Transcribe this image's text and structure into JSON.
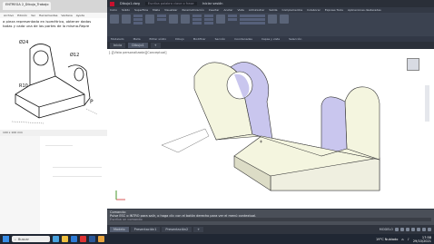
{
  "paint": {
    "tab_title": "ENTREGA 2_Dibujo_Trabajo",
    "tab2": "Herramientas",
    "menu": [
      "Archivo",
      "Edición",
      "Ver",
      "Herramientas",
      "Ventana",
      "Ayuda"
    ],
    "text_line1": "a pieza representada en isométrico, obtener dadas",
    "text_line2": "todas y cada una de las partes de la misma.Repre",
    "dims": {
      "d1": "Ø24",
      "d2": "Ø12",
      "d3": "R10",
      "p": "P"
    },
    "status": "100 x 100 mm"
  },
  "cad": {
    "title": "Dibujo1.dwg",
    "search_placeholder": "Escriba palabra clave o frase",
    "user": "Iniciar sesión",
    "tabs": [
      "Inicio",
      "Sólido",
      "Superficie",
      "Malla",
      "Visualizar",
      "Parametrización",
      "Insertar",
      "Anotar",
      "Vista",
      "Administrar",
      "Salida",
      "Complementos",
      "Colaborar",
      "Express Tools",
      "Aplicaciones destacadas"
    ],
    "panels": [
      "Modelado",
      "Malla",
      "Editar sólido",
      "Dibujo",
      "Modificar",
      "Sección",
      "Coordenadas",
      "Capas y vista",
      "Selección"
    ],
    "file_tabs": [
      "Inicio",
      "Dibujo1"
    ],
    "viewport_label": "[-][Vista personalizada][Conceptual]",
    "cmd_lines": [
      "Comando:",
      "Pulse ESC o INTRO para salir, o haga clic con el botón derecho para ver el menú contextual."
    ],
    "cmd_prompt": "Escriba un comando",
    "layouts": [
      "Modelo",
      "Presentación1",
      "Presentación2"
    ],
    "status_text": "MODELO"
  },
  "taskbar": {
    "search": "Buscar",
    "weather": "19°C Nublado",
    "time": "17:58",
    "date": "29/10/2021"
  }
}
